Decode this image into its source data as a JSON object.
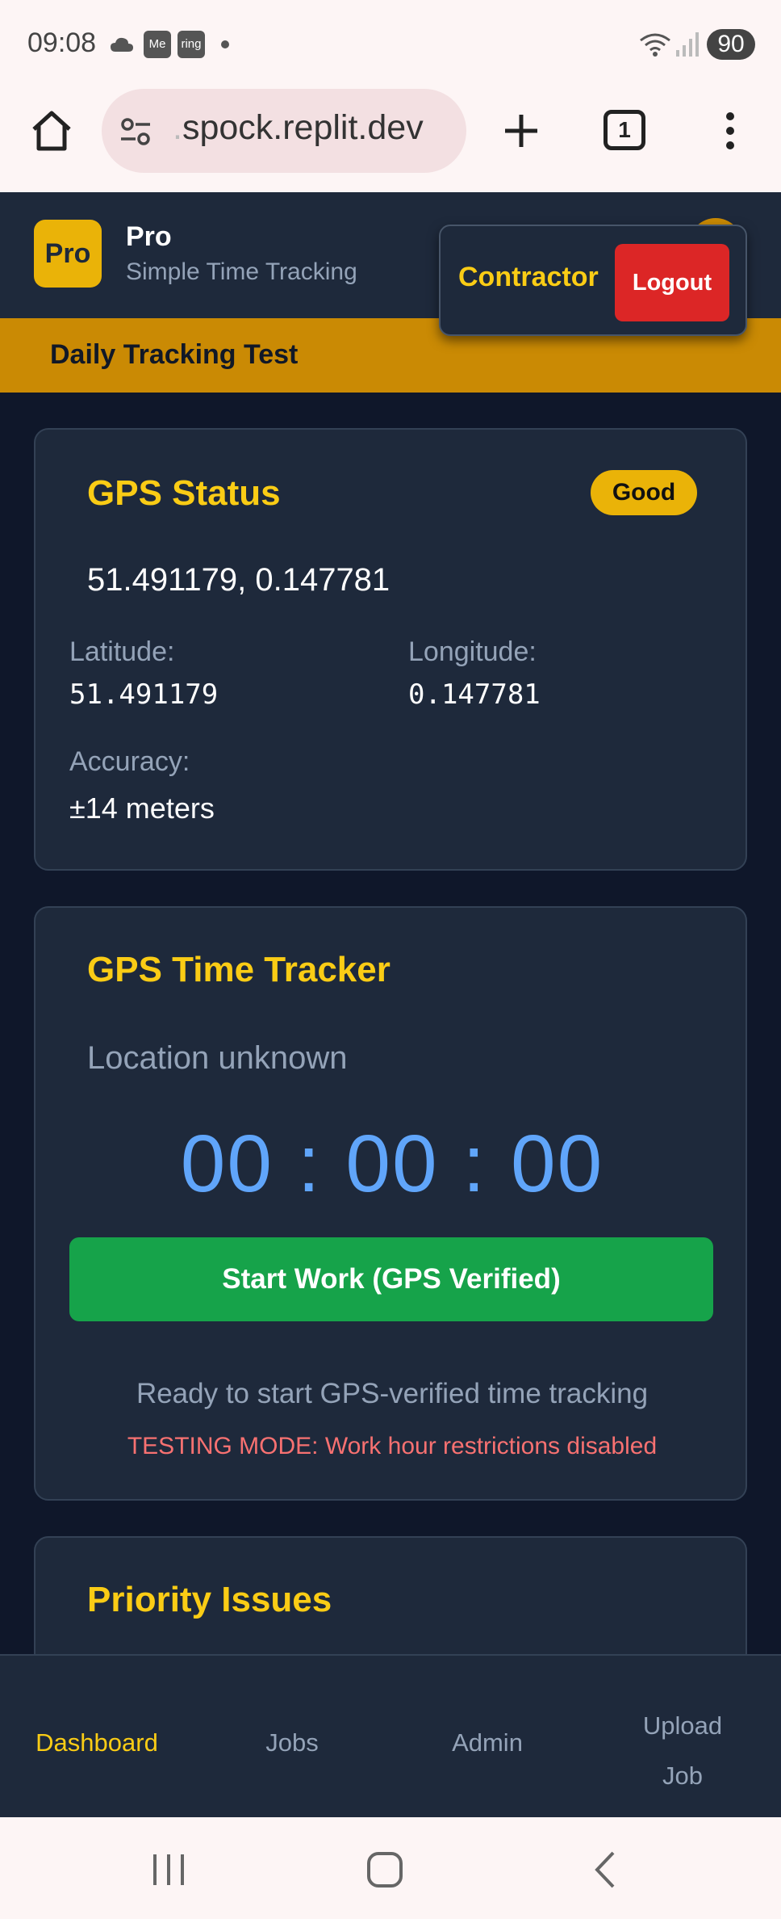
{
  "status_bar": {
    "time": "09:08",
    "notification_badges": [
      "Me",
      "ring"
    ],
    "battery": "90"
  },
  "browser": {
    "url": "spock.replit.dev",
    "url_prefix_faded": ".",
    "tab_count": "1"
  },
  "app": {
    "logo": "Pro",
    "name": "Pro",
    "subtitle": "Simple Time Tracking",
    "user_role": "Contractor",
    "logout_label": "Logout",
    "banner": "Daily Tracking Test"
  },
  "gps_status": {
    "title": "GPS Status",
    "badge": "Good",
    "coordinates": "51.491179, 0.147781",
    "latitude_label": "Latitude:",
    "latitude": "51.491179",
    "longitude_label": "Longitude:",
    "longitude": "0.147781",
    "accuracy_label": "Accuracy:",
    "accuracy": "±14 meters"
  },
  "time_tracker": {
    "title": "GPS Time Tracker",
    "location": "Location unknown",
    "timer": "00 : 00 : 00",
    "start_button": "Start Work (GPS Verified)",
    "ready_text": "Ready to start GPS-verified time tracking",
    "testing_text": "TESTING MODE: Work hour restrictions disabled"
  },
  "priority_issues": {
    "title": "Priority Issues"
  },
  "bottom_nav": {
    "dashboard": "Dashboard",
    "jobs": "Jobs",
    "admin": "Admin",
    "upload_line1": "Upload",
    "upload_line2": "Job"
  },
  "colors": {
    "accent": "#facc15",
    "header_bg": "#1e293b",
    "banner_bg": "#ca8a04",
    "start_button": "#16a34a",
    "logout_button": "#dc2626",
    "timer": "#60a5fa"
  }
}
